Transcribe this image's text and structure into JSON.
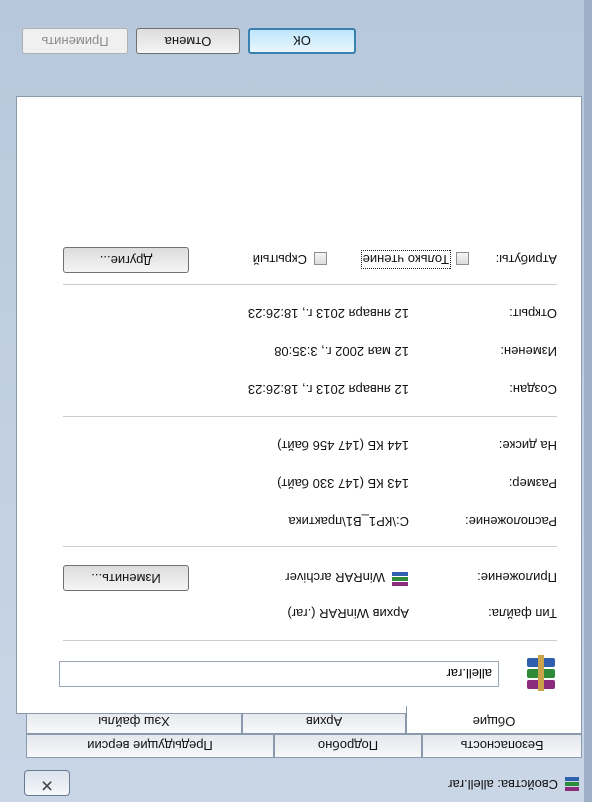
{
  "window": {
    "title": "Свойства: allell.rar",
    "close_glyph": "✕"
  },
  "tabs": {
    "row1": [
      {
        "label": "Безопасность"
      },
      {
        "label": "Подробно"
      },
      {
        "label": "Предыдущие версии"
      }
    ],
    "row2": [
      {
        "label": "Общие"
      },
      {
        "label": "Архив"
      },
      {
        "label": "Хэш файлы"
      }
    ]
  },
  "general": {
    "file_name": "allell.rar",
    "file_type_label": "Тип файла:",
    "file_type_value": "Архив WinRAR (.rar)",
    "app_label": "Приложение:",
    "app_value": "WinRAR archiver",
    "change_button": "Изменить...",
    "location_label": "Расположение:",
    "location_value": "C:\\КР1_В1\\практика",
    "size_label": "Размер:",
    "size_value": "143 КБ (147 330 байт)",
    "disk_label": "На диске:",
    "disk_value": "144 КБ (147 456 байт)",
    "created_label": "Создан:",
    "created_value": "12 января 2013 г., 18:26:23",
    "modified_label": "Изменен:",
    "modified_value": "12 мая 2002 г., 3:35:08",
    "opened_label": "Открыт:",
    "opened_value": "12 января 2013 г., 18:26:23",
    "attributes_label": "Атрибуты:",
    "readonly_label": "Только чтение",
    "readonly_checked": false,
    "hidden_label": "Скрытый",
    "hidden_checked": false,
    "other_button": "Другие..."
  },
  "footer": {
    "ok_label": "ОК",
    "cancel_label": "Отмена",
    "apply_label": "Применить"
  },
  "icons": {
    "app": "winrar-icon",
    "file": "winrar-archive-icon",
    "close": "close-icon"
  }
}
